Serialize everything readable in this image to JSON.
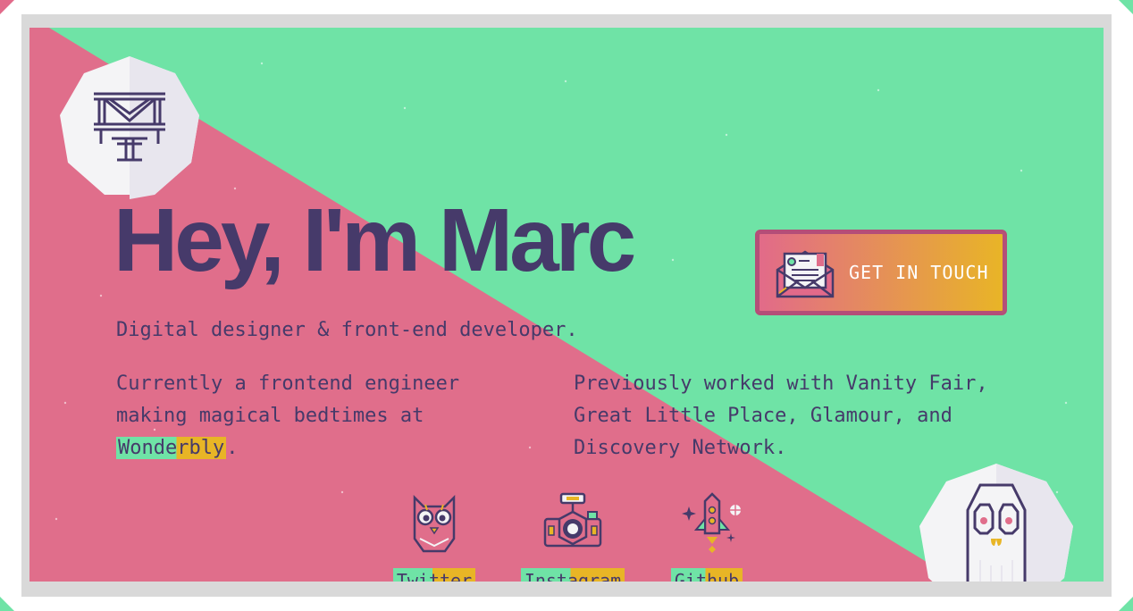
{
  "hero": {
    "title": "Hey, I'm Marc",
    "tagline": "Digital designer & front-end developer.",
    "current": {
      "before": "Currently a frontend engineer making magical bedtimes at ",
      "link": "Wonderbly",
      "after": "."
    },
    "previous": "Previously worked with Vanity Fair, Great Little Place, Glamour, and Discovery Network."
  },
  "cta": {
    "label": "GET IN TOUCH",
    "icon": "envelope-letter-icon"
  },
  "social": [
    {
      "label": "Twitter",
      "icon": "owl-icon"
    },
    {
      "label": "Instagram",
      "icon": "camera-icon"
    },
    {
      "label": "Github",
      "icon": "rocket-icon"
    }
  ],
  "colors": {
    "green": "#6fe3a6",
    "pink": "#e06e8b",
    "purple": "#463a6a",
    "yellow": "#e8b526",
    "frame": "#d9d9d9"
  }
}
